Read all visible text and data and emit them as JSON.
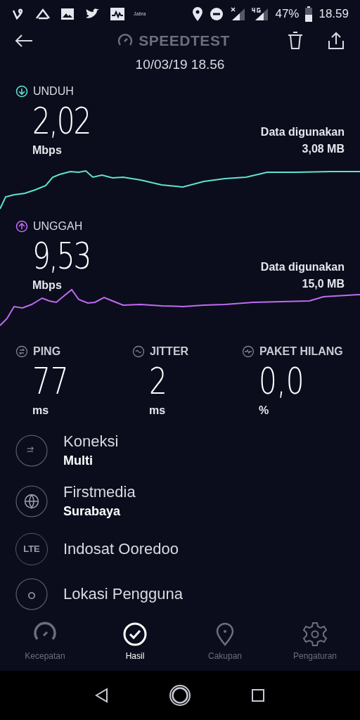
{
  "status_bar": {
    "notification_label": "Jabra",
    "battery": "47%",
    "time": "18.59"
  },
  "toolbar": {
    "title": "SPEEDTEST"
  },
  "date": "10/03/19 18.56",
  "results": [
    {
      "kind": "download",
      "label": "UNDUH",
      "value": "2,02",
      "unit": "Mbps",
      "data_label": "Data digunakan",
      "data_value": "3,08 MB",
      "color": "#5fe3d1"
    },
    {
      "kind": "upload",
      "label": "UNGGAH",
      "value": "9,53",
      "unit": "Mbps",
      "data_label": "Data digunakan",
      "data_value": "15,0 MB",
      "color": "#c06bf2"
    }
  ],
  "stats": [
    {
      "kind": "ping",
      "label": "PING",
      "value": "77",
      "unit": "ms"
    },
    {
      "kind": "jitter",
      "label": "JITTER",
      "value": "2",
      "unit": "ms"
    },
    {
      "kind": "loss",
      "label": "PAKET HILANG",
      "value": "0,0",
      "unit": "%"
    }
  ],
  "details": [
    {
      "kind": "connection",
      "title": "Koneksi",
      "subtitle": "Multi"
    },
    {
      "kind": "server",
      "title": "Firstmedia",
      "subtitle": "Surabaya"
    },
    {
      "kind": "provider",
      "title": "Indosat Ooredoo",
      "icon_text": "LTE"
    },
    {
      "kind": "location",
      "title": "Lokasi Pengguna"
    }
  ],
  "bottom_nav": [
    {
      "kind": "speed",
      "label": "Kecepatan",
      "selected": false
    },
    {
      "kind": "results",
      "label": "Hasil",
      "selected": true
    },
    {
      "kind": "coverage",
      "label": "Cakupan",
      "selected": false
    },
    {
      "kind": "settings",
      "label": "Pengaturan",
      "selected": false
    }
  ]
}
